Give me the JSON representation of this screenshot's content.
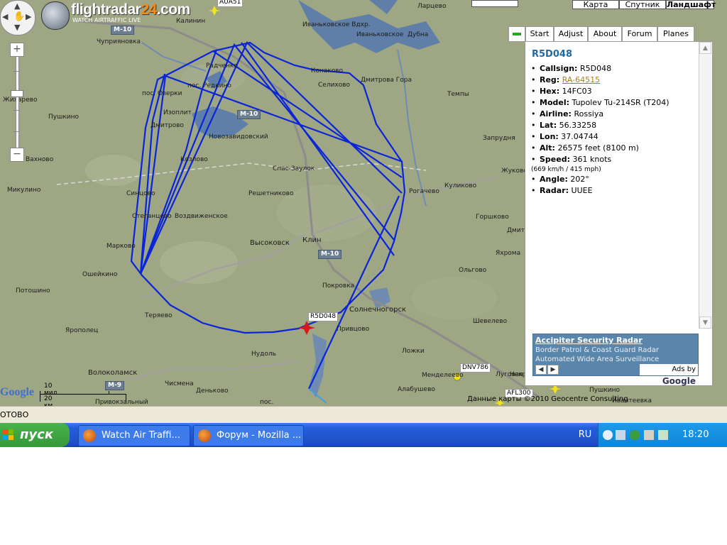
{
  "map": {
    "logo_main": "flightradar",
    "logo_num": "24",
    "logo_dom": ".com",
    "logo_sub": "WATCH AIRTRAFFIC LIVE",
    "map_types": [
      "Карта",
      "Спутник",
      "Ландшафт"
    ],
    "active_map_type": "Ландшафт",
    "places": [
      "Чуприяновка",
      "Радченко",
      "Калинин",
      "Иваньковское Вдхр.",
      "Иваньковское",
      "Дубна",
      "Ларцево",
      "Конаково",
      "Селихово",
      "Дмитрова Гора",
      "Темпы",
      "Запрудня",
      "пос. Озерки",
      "пос. Редкино",
      "Изоплит",
      "Дмитрово",
      "Новозавидовский",
      "Пушкино",
      "Спас-Заулок",
      "Козлово",
      "Вахново",
      "Микулино",
      "Синцово",
      "Решетниково",
      "Рогачево",
      "Куликово",
      "Жуковский",
      "Стеганцево",
      "Воздвиженское",
      "Марково",
      "Высоковск",
      "Клин",
      "Горшково",
      "Дмит",
      "Яхрома",
      "Ошейкино",
      "Потошино",
      "Ольгово",
      "Покровка",
      "Солнечногорск",
      "Теряево",
      "Ярополец",
      "Шевелево",
      "Привцово",
      "Нудоль",
      "Ложки",
      "Волоколамск",
      "Менделеево",
      "Некрасовский",
      "Луговая",
      "Чисмена",
      "Деньково",
      "Алабушево",
      "Пушкино",
      "Привокзальный",
      "пос.",
      "Ивантеевка",
      "Жихарево"
    ],
    "highways": [
      "M-10",
      "M-10",
      "M-10",
      "M-9"
    ],
    "flights": [
      {
        "callsign": "AUA51"
      },
      {
        "callsign": "R5D048"
      },
      {
        "callsign": "DNV786"
      },
      {
        "callsign": "AFL300"
      }
    ],
    "scale_miles": "10 мил.",
    "scale_km": "20 км",
    "google": "Google",
    "copyright": "Данные карты ©2010 Geocentre Consulting"
  },
  "tabs": [
    "",
    "Start",
    "Adjust",
    "About",
    "Forum",
    "Planes"
  ],
  "flight_info": {
    "title": "R5D048",
    "callsign_label": "Callsign:",
    "callsign": "R5D048",
    "reg_label": "Reg:",
    "reg": "RA-64515",
    "hex_label": "Hex:",
    "hex": "14FC03",
    "model_label": "Model:",
    "model": "Tupolev Tu-214SR (T204)",
    "airline_label": "Airline:",
    "airline": "Rossiya",
    "lat_label": "Lat:",
    "lat": "56.33258",
    "lon_label": "Lon:",
    "lon": "37.04744",
    "alt_label": "Alt:",
    "alt": "26575 feet (8100 m)",
    "speed_label": "Speed:",
    "speed": "361 knots",
    "speed_sub": "(669 km/h / 415 mph)",
    "angle_label": "Angle:",
    "angle": "202°",
    "radar_label": "Radar:",
    "radar": "UUEE"
  },
  "ad": {
    "title": "Accipiter Security Radar",
    "line1": "Border Patrol & Coast Guard Radar",
    "line2": "Automated Wide Area Surveillance",
    "ads_by": "Ads by",
    "google": "Google"
  },
  "status": "ОТОВО",
  "taskbar": {
    "start": "пуск",
    "tasks": [
      "Watch Air Traffi...",
      "Форум - Mozilla ..."
    ],
    "lang": "RU",
    "clock": "18:20"
  },
  "colors": {
    "map_bg": "#9ea684",
    "track": "#0a24d8",
    "water": "#5f7fa8",
    "taskbar": "#245edb",
    "start": "#3a9a3a"
  }
}
